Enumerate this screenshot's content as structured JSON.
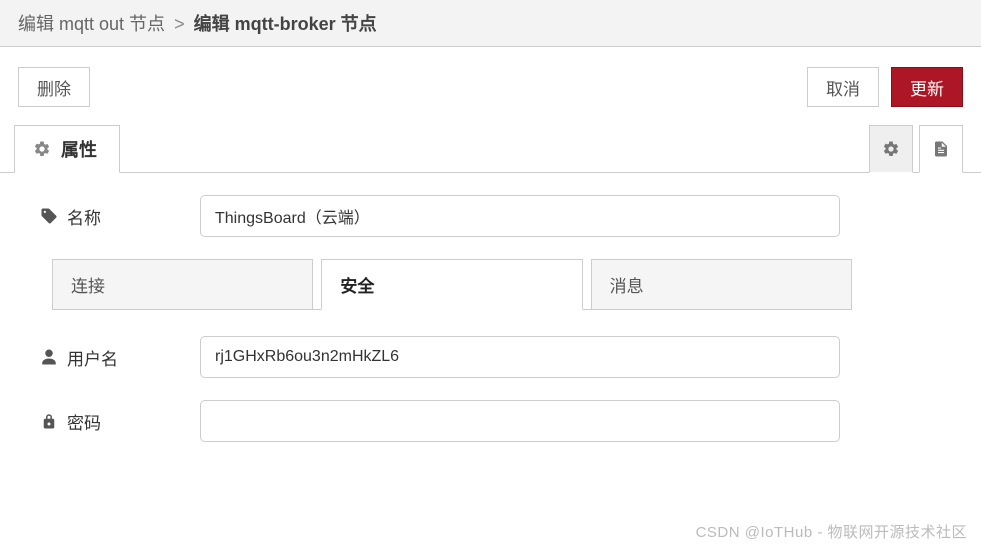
{
  "breadcrumb": {
    "parent": "编辑 mqtt out 节点",
    "separator": ">",
    "current": "编辑 mqtt-broker 节点"
  },
  "toolbar": {
    "delete_label": "删除",
    "cancel_label": "取消",
    "update_label": "更新"
  },
  "topTabs": {
    "properties_label": "属性"
  },
  "form": {
    "name": {
      "label": "名称",
      "value": "ThingsBoard（云端）"
    },
    "tabs": {
      "connection": "连接",
      "security": "安全",
      "messages": "消息"
    },
    "user": {
      "label": "用户名",
      "value": "rj1GHxRb6ou3n2mHkZL6"
    },
    "password": {
      "label": "密码",
      "value": ""
    }
  },
  "watermark": "CSDN @IoTHub - 物联网开源技术社区"
}
